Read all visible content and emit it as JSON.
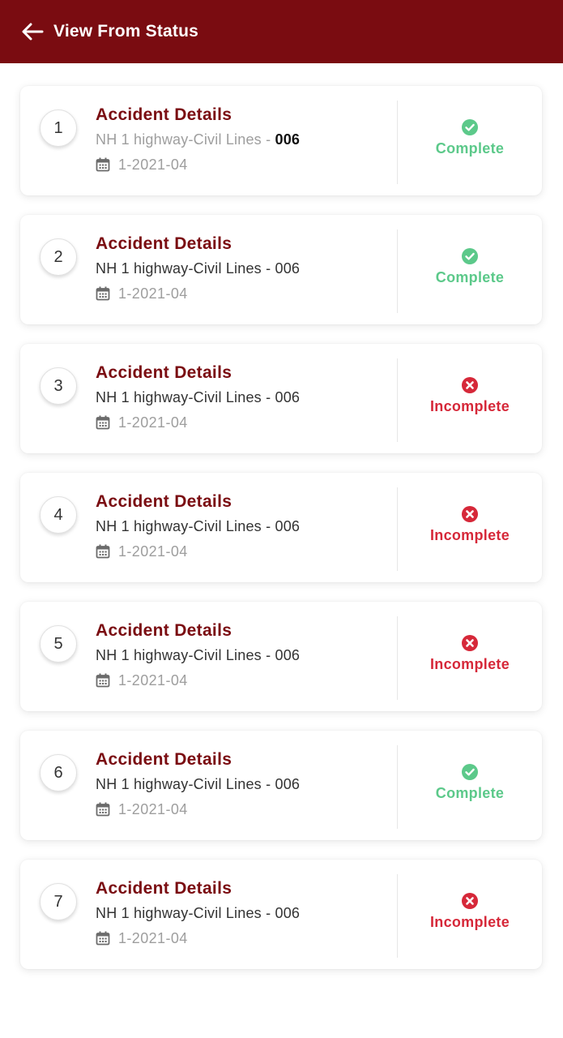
{
  "header": {
    "title": "View From Status",
    "background_color": "#7a0c11"
  },
  "colors": {
    "complete": "#5cc98a",
    "incomplete": "#d62839",
    "title": "#7a0c11"
  },
  "records": [
    {
      "number": "1",
      "title": "Accident Details",
      "location": "NH 1 highway-Civil Lines - ",
      "code": "006",
      "date": "1-2021-04",
      "status": "Complete",
      "state": "complete",
      "icon": "check-circle-icon"
    },
    {
      "number": "2",
      "title": "Accident Details",
      "location": "NH 1 highway-Civil Lines - ",
      "code": "006",
      "date": "1-2021-04",
      "status": "Complete",
      "state": "complete",
      "icon": "check-circle-icon"
    },
    {
      "number": "3",
      "title": "Accident Details",
      "location": "NH 1 highway-Civil Lines - ",
      "code": "006",
      "date": "1-2021-04",
      "status": "Incomplete",
      "state": "incomplete",
      "icon": "x-circle-icon"
    },
    {
      "number": "4",
      "title": "Accident Details",
      "location": "NH 1 highway-Civil Lines - ",
      "code": "006",
      "date": "1-2021-04",
      "status": "Incomplete",
      "state": "incomplete",
      "icon": "x-circle-icon"
    },
    {
      "number": "5",
      "title": "Accident Details",
      "location": "NH 1 highway-Civil Lines - ",
      "code": "006",
      "date": "1-2021-04",
      "status": "Incomplete",
      "state": "incomplete",
      "icon": "x-circle-icon"
    },
    {
      "number": "6",
      "title": "Accident Details",
      "location": "NH 1 highway-Civil Lines - ",
      "code": "006",
      "date": "1-2021-04",
      "status": "Complete",
      "state": "complete",
      "icon": "check-circle-icon"
    },
    {
      "number": "7",
      "title": "Accident Details",
      "location": "NH 1 highway-Civil Lines - ",
      "code": "006",
      "date": "1-2021-04",
      "status": "Incomplete",
      "state": "incomplete",
      "icon": "x-circle-icon"
    }
  ]
}
